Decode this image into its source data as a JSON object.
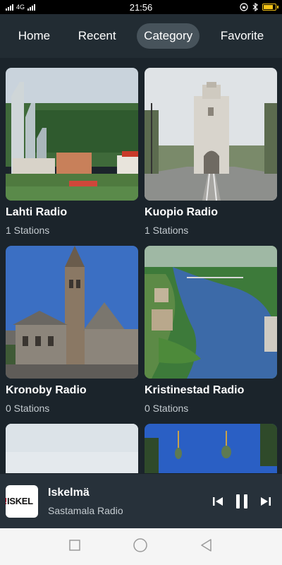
{
  "status_bar": {
    "left_text": "4G",
    "time": "21:56"
  },
  "tabs": [
    {
      "label": "Home",
      "active": false
    },
    {
      "label": "Recent",
      "active": false
    },
    {
      "label": "Category",
      "active": true
    },
    {
      "label": "Favorite",
      "active": false
    }
  ],
  "categories": [
    {
      "title": "Lahti Radio",
      "subtitle": "1 Stations",
      "image": "ski-jump-town-photo"
    },
    {
      "title": "Kuopio Radio",
      "subtitle": "1 Stations",
      "image": "church-steps-photo"
    },
    {
      "title": "Kronoby Radio",
      "subtitle": "0 Stations",
      "image": "stone-tower-building-photo"
    },
    {
      "title": "Kristinestad Radio",
      "subtitle": "0 Stations",
      "image": "aerial-river-town-photo"
    },
    {
      "title": "",
      "subtitle": "",
      "image": "sky-photo"
    },
    {
      "title": "",
      "subtitle": "",
      "image": "onion-domes-photo"
    }
  ],
  "player": {
    "logo_text": "ISKEL",
    "title": "Iskelmä",
    "subtitle": "Sastamala Radio",
    "icons": [
      "previous-icon",
      "pause-icon",
      "next-icon"
    ]
  },
  "navbar": {
    "icons": [
      "recents-square-icon",
      "home-circle-icon",
      "back-triangle-icon"
    ]
  },
  "colors": {
    "background": "#1b242b",
    "tab_bar": "#222c33",
    "active_tab": "#47535b",
    "player": "#27313a",
    "battery": "#f5c518"
  }
}
